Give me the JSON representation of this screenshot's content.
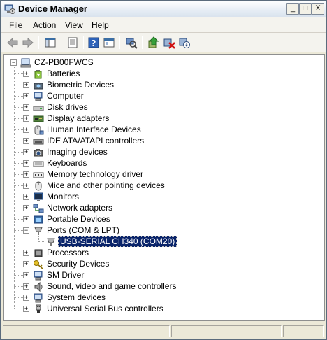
{
  "window": {
    "title": "Device Manager",
    "controls": {
      "minimize": "_",
      "maximize": "□",
      "close": "X"
    }
  },
  "menu": {
    "items": [
      {
        "label": "File",
        "name": "menu-file"
      },
      {
        "label": "Action",
        "name": "menu-action"
      },
      {
        "label": "View",
        "name": "menu-view"
      },
      {
        "label": "Help",
        "name": "menu-help"
      }
    ]
  },
  "toolbar": {
    "buttons": [
      "back-arrow-icon",
      "forward-arrow-icon",
      "show-hide-console-tree-icon",
      "properties-icon",
      "help-icon",
      "view-icon",
      "scan-hardware-icon",
      "update-driver-icon",
      "uninstall-icon",
      "disable-icon"
    ]
  },
  "tree": {
    "root": "CZ-PB00FWCS",
    "categories": [
      {
        "label": "Batteries",
        "icon": "battery-icon",
        "expanded": false
      },
      {
        "label": "Biometric Devices",
        "icon": "biometric-icon",
        "expanded": false
      },
      {
        "label": "Computer",
        "icon": "computer-icon",
        "expanded": false
      },
      {
        "label": "Disk drives",
        "icon": "disk-drive-icon",
        "expanded": false
      },
      {
        "label": "Display adapters",
        "icon": "display-adapter-icon",
        "expanded": false
      },
      {
        "label": "Human Interface Devices",
        "icon": "hid-icon",
        "expanded": false
      },
      {
        "label": "IDE ATA/ATAPI controllers",
        "icon": "ide-controller-icon",
        "expanded": false
      },
      {
        "label": "Imaging devices",
        "icon": "camera-icon",
        "expanded": false
      },
      {
        "label": "Keyboards",
        "icon": "keyboard-icon",
        "expanded": false
      },
      {
        "label": "Memory technology driver",
        "icon": "memory-icon",
        "expanded": false
      },
      {
        "label": "Mice and other pointing devices",
        "icon": "mouse-icon",
        "expanded": false
      },
      {
        "label": "Monitors",
        "icon": "monitor-icon",
        "expanded": false
      },
      {
        "label": "Network adapters",
        "icon": "network-icon",
        "expanded": false
      },
      {
        "label": "Portable Devices",
        "icon": "portable-device-icon",
        "expanded": false
      },
      {
        "label": "Ports (COM & LPT)",
        "icon": "port-icon",
        "expanded": true,
        "children": [
          {
            "label": "USB-SERIAL CH340 (COM20)",
            "icon": "port-icon",
            "selected": true
          }
        ]
      },
      {
        "label": "Processors",
        "icon": "processor-icon",
        "expanded": false
      },
      {
        "label": "Security Devices",
        "icon": "security-key-icon",
        "expanded": false
      },
      {
        "label": "SM Driver",
        "icon": "sm-driver-icon",
        "expanded": false
      },
      {
        "label": "Sound, video and game controllers",
        "icon": "speaker-icon",
        "expanded": false
      },
      {
        "label": "System devices",
        "icon": "system-device-icon",
        "expanded": false
      },
      {
        "label": "Universal Serial Bus controllers",
        "icon": "usb-icon",
        "expanded": false
      }
    ]
  },
  "colors": {
    "selection": "#0a246a",
    "window_bg": "#ece9d8"
  }
}
